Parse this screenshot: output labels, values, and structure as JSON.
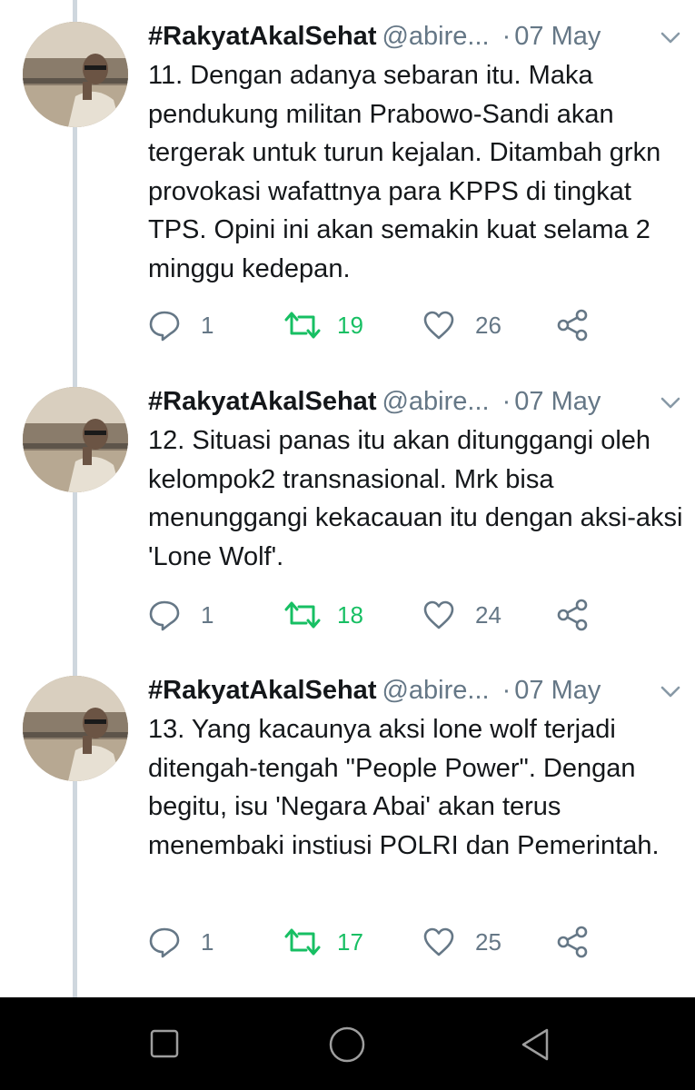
{
  "colors": {
    "text": "#14171a",
    "muted": "#657786",
    "retweet_green": "#17bf63",
    "thread_line": "#cfd7de",
    "nav_bar": "#000000"
  },
  "tweets": [
    {
      "name": "#RakyatAkalSehat",
      "handle": "@abire...",
      "dot": "·",
      "date": "07 May",
      "text": "11. Dengan adanya sebaran itu. Maka pendukung militan Prabowo-Sandi akan tergerak untuk turun kejalan. Ditambah grkn provokasi wafattnya para KPPS di tingkat TPS. Opini ini akan semakin kuat selama 2 minggu kedepan.",
      "replies": "1",
      "retweets": "19",
      "likes": "26"
    },
    {
      "name": "#RakyatAkalSehat",
      "handle": "@abire...",
      "dot": "·",
      "date": "07 May",
      "text": "12. Situasi panas itu akan ditunggangi oleh kelompok2 transnasional. Mrk bisa menunggangi kekacauan itu dengan aksi-aksi 'Lone Wolf'.",
      "replies": "1",
      "retweets": "18",
      "likes": "24"
    },
    {
      "name": "#RakyatAkalSehat",
      "handle": "@abire...",
      "dot": "·",
      "date": "07 May",
      "text": "13. Yang kacaunya aksi lone wolf terjadi ditengah-tengah \"People Power\". Dengan begitu, isu 'Negara Abai' akan terus menembaki instiusi POLRI dan Pemerintah.",
      "replies": "1",
      "retweets": "17",
      "likes": "25"
    }
  ],
  "icons": {
    "reply": "reply-icon",
    "retweet": "retweet-icon",
    "like": "heart-icon",
    "share": "share-icon",
    "menu": "chevron-down-icon",
    "nav_recents": "square-icon",
    "nav_home": "circle-icon",
    "nav_back": "triangle-back-icon"
  }
}
